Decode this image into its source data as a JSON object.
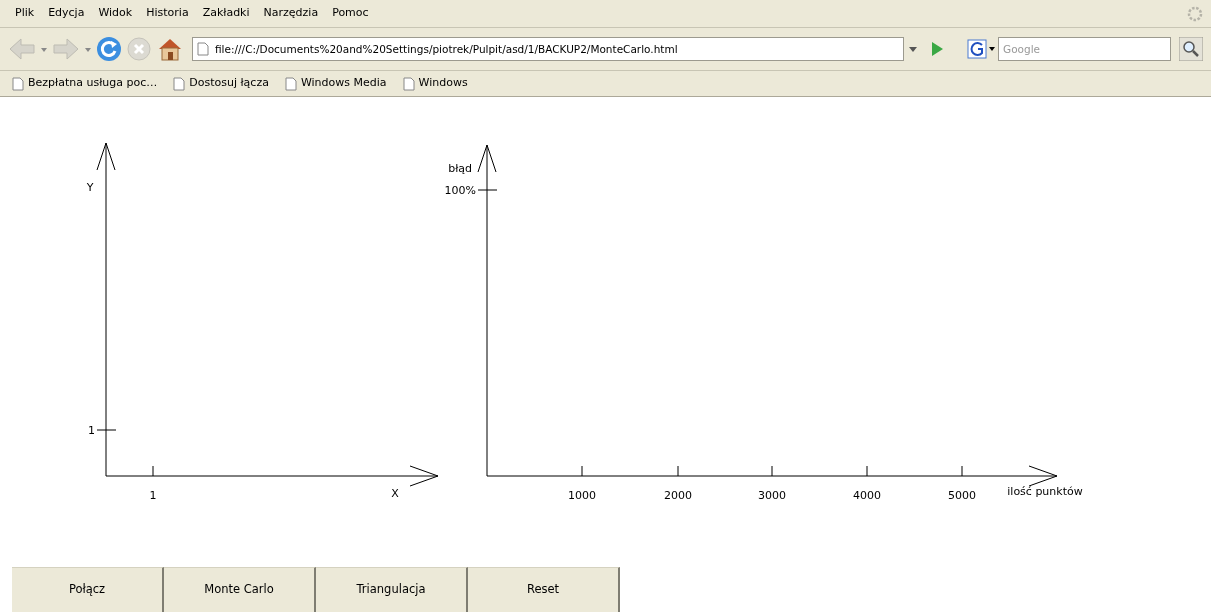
{
  "menu": [
    "Plik",
    "Edycja",
    "Widok",
    "Historia",
    "Zakładki",
    "Narzędzia",
    "Pomoc"
  ],
  "address": {
    "value": "file:///C:/Documents%20and%20Settings/piotrek/Pulpit/asd/1/BACKUP2/MonteCarlo.html"
  },
  "search": {
    "placeholder": "Google"
  },
  "bookmarks": [
    "Bezpłatna usługa poc…",
    "Dostosuj łącza",
    "Windows Media",
    "Windows"
  ],
  "plots": [
    {
      "y_label": "Y",
      "x_label": "X",
      "y_ticks": [
        "1"
      ],
      "x_ticks": [
        "1"
      ]
    },
    {
      "y_label": "błąd",
      "x_label": "ilość punktów",
      "y_ticks": [
        "100%"
      ],
      "x_ticks": [
        "1000",
        "2000",
        "3000",
        "4000",
        "5000"
      ]
    }
  ],
  "buttons": [
    "Połącz",
    "Monte Carlo",
    "Triangulacja",
    "Reset"
  ]
}
